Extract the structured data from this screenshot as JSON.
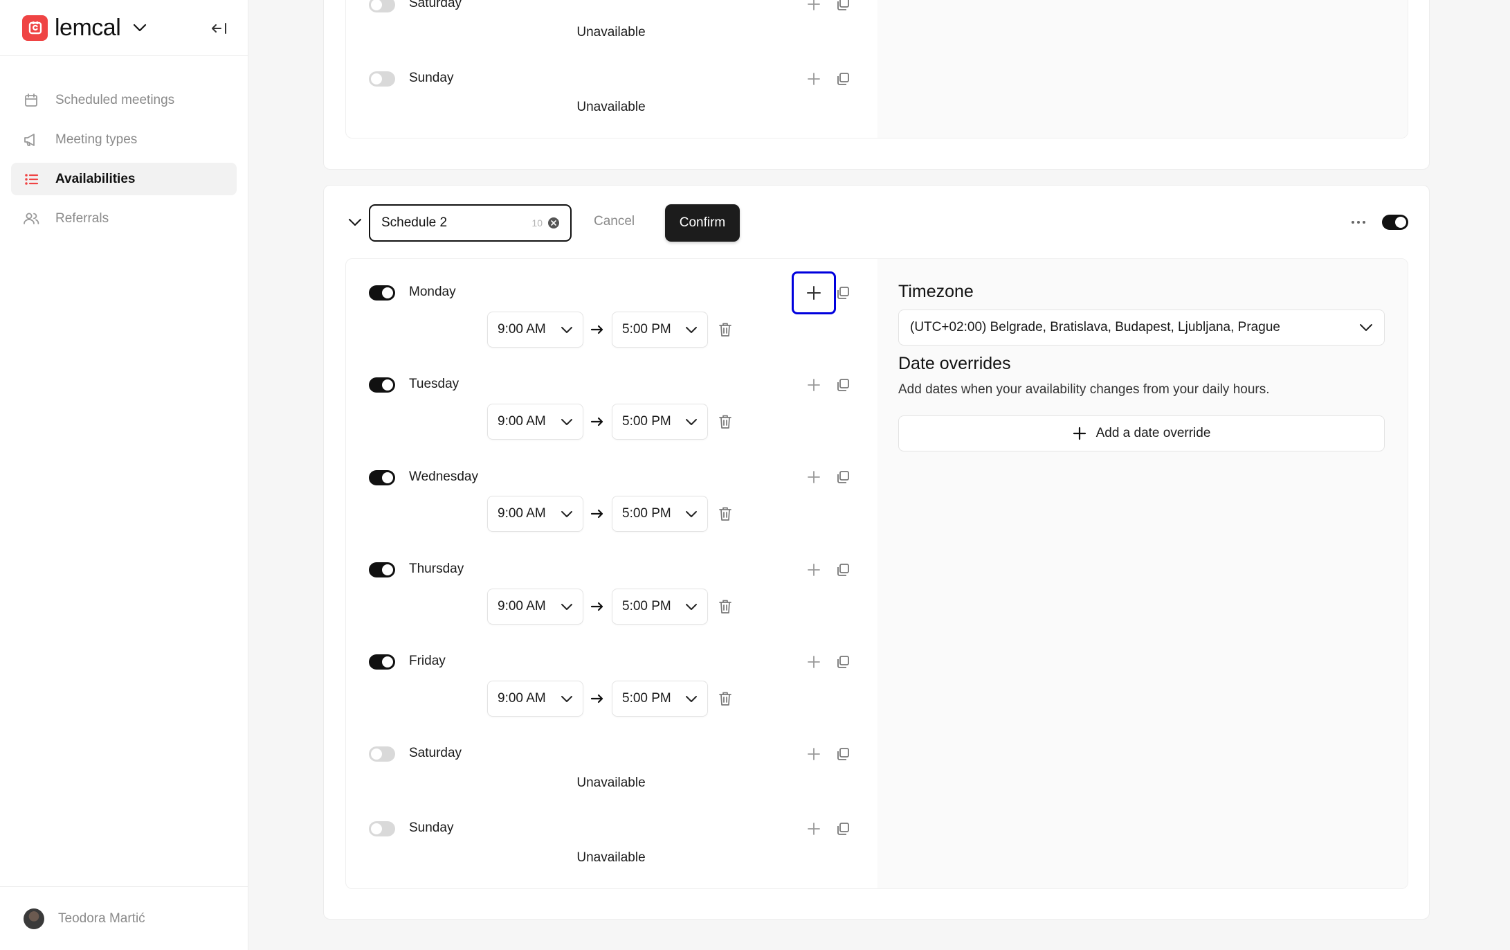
{
  "brand": {
    "name": "lemcal"
  },
  "nav": [
    {
      "label": "Scheduled meetings",
      "icon": "calendar-icon",
      "active": false
    },
    {
      "label": "Meeting types",
      "icon": "megaphone-icon",
      "active": false
    },
    {
      "label": "Availabilities",
      "icon": "list-icon",
      "active": true
    },
    {
      "label": "Referrals",
      "icon": "users-icon",
      "active": false
    }
  ],
  "user": {
    "name": "Teodora Martić"
  },
  "schedule1": {
    "days": [
      {
        "name": "Saturday",
        "status": "Unavailable"
      },
      {
        "name": "Sunday",
        "status": "Unavailable"
      }
    ]
  },
  "schedule2": {
    "name_value": "Schedule 2",
    "char_count": "10",
    "cancel_label": "Cancel",
    "confirm_label": "Confirm",
    "days": [
      {
        "name": "Monday",
        "start": "9:00 AM",
        "end": "5:00 PM"
      },
      {
        "name": "Tuesday",
        "start": "9:00 AM",
        "end": "5:00 PM"
      },
      {
        "name": "Wednesday",
        "start": "9:00 AM",
        "end": "5:00 PM"
      },
      {
        "name": "Thursday",
        "start": "9:00 AM",
        "end": "5:00 PM"
      },
      {
        "name": "Friday",
        "start": "9:00 AM",
        "end": "5:00 PM"
      },
      {
        "name": "Saturday",
        "status": "Unavailable"
      },
      {
        "name": "Sunday",
        "status": "Unavailable"
      }
    ],
    "timezone_title": "Timezone",
    "timezone_value": "(UTC+02:00) Belgrade, Bratislava, Budapest, Ljubljana, Prague",
    "overrides_title": "Date overrides",
    "overrides_desc": "Add dates when your availability changes from your daily hours.",
    "add_override_label": "Add a date override"
  },
  "colors": {
    "brand": "#ef4444",
    "highlight": "#0000dd",
    "toggle_on": "#111111"
  }
}
